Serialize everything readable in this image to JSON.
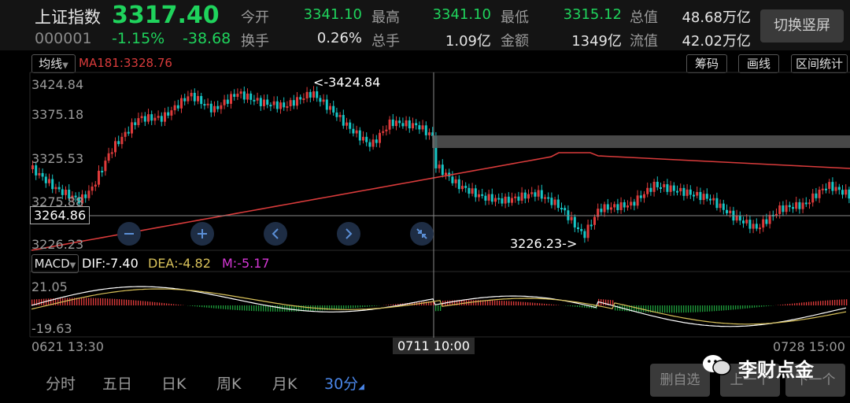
{
  "header": {
    "name": "上证指数",
    "price": "3317.40",
    "code": "000001",
    "change_pct": "-1.15%",
    "change": "-38.68",
    "stats": [
      {
        "label": "今开",
        "value": "3341.10",
        "color": "green"
      },
      {
        "label": "最高",
        "value": "3341.10",
        "color": "green"
      },
      {
        "label": "最低",
        "value": "3315.12",
        "color": "green"
      },
      {
        "label": "总值",
        "value": "48.68万亿",
        "color": "white"
      },
      {
        "label": "换手",
        "value": "0.26%",
        "color": "white"
      },
      {
        "label": "总手",
        "value": "1.09亿",
        "color": "white"
      },
      {
        "label": "金额",
        "value": "1349亿",
        "color": "white"
      },
      {
        "label": "流值",
        "value": "42.02万亿",
        "color": "white"
      }
    ],
    "switch_button": "切换竖屏"
  },
  "chart_toolbar": {
    "indicator": "均线",
    "ma_text": "MA181:3328.76",
    "buttons": [
      "筹码",
      "画线",
      "区间统计"
    ]
  },
  "price_chart": {
    "y_ticks": [
      "3424.84",
      "3375.18",
      "3325.53",
      "3275.88",
      "3226.23"
    ],
    "crosshair_value": "3264.86",
    "high_label": "<-3424.84",
    "low_label": "3226.23->",
    "controls": [
      "zoom-out",
      "zoom-in",
      "prev",
      "next",
      "fullscreen"
    ]
  },
  "macd": {
    "indicator": "MACD",
    "dif": "DIF:-7.40",
    "dea": "DEA:-4.82",
    "m": "M:-5.17",
    "y_ticks": [
      "21.05",
      "-19.63"
    ]
  },
  "x_axis": {
    "left": "0621 13:30",
    "cursor": "0711 10:00",
    "right": "0728 15:00"
  },
  "tabs": [
    "分时",
    "五日",
    "日K",
    "周K",
    "月K",
    "30分"
  ],
  "active_tab": "30分",
  "bottom_buttons": [
    "删自选",
    "上一个",
    "下一个"
  ],
  "watermark": "李财点金",
  "colors": {
    "up": "#e03b3b",
    "down": "#16c6c6",
    "green": "#1fd35c",
    "ma": "#d93b3b",
    "dea": "#d8c15a"
  }
}
